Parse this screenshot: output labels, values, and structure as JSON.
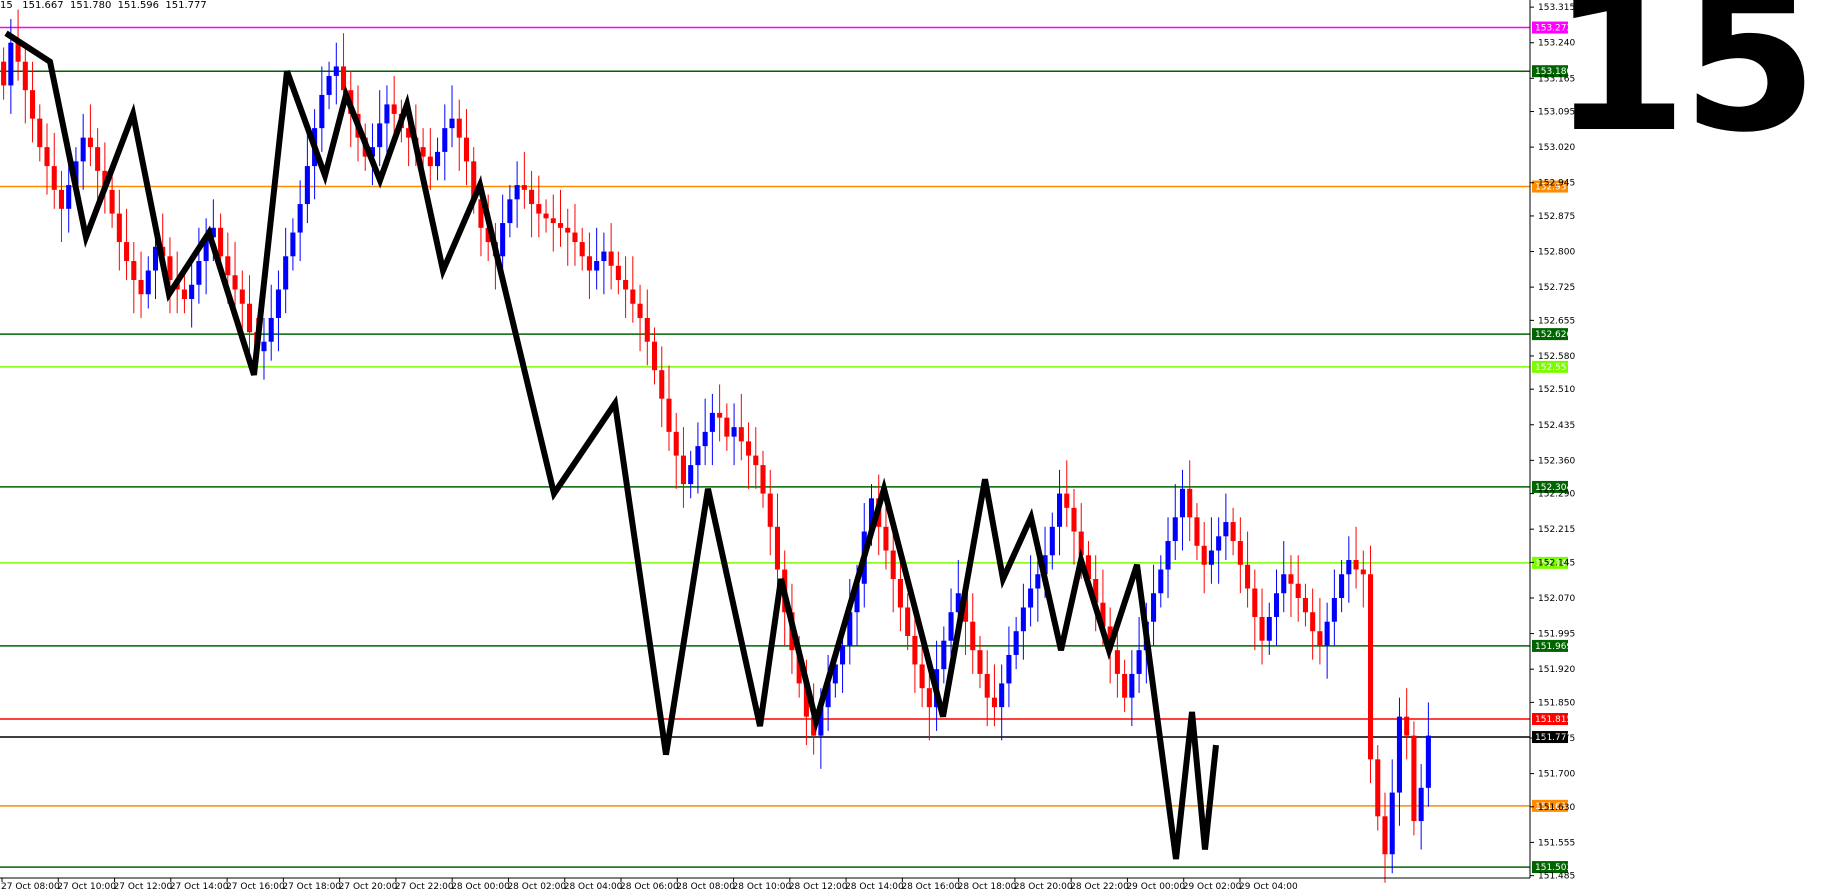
{
  "header": {
    "ohlc_text": "15   151.667  151.780  151.596  151.777"
  },
  "timeframe_label": "15",
  "chart_data": {
    "type": "candlestick",
    "ylim": [
      151.48,
      153.33
    ],
    "y_ticks": [
      "153.315",
      "153.240",
      "153.165",
      "153.095",
      "153.020",
      "152.945",
      "152.875",
      "152.800",
      "152.725",
      "152.655",
      "152.580",
      "152.510",
      "152.435",
      "152.360",
      "152.290",
      "152.215",
      "152.145",
      "152.070",
      "151.995",
      "151.920",
      "151.850",
      "151.775",
      "151.700",
      "151.630",
      "151.555",
      "151.485"
    ],
    "x_ticks": [
      "27 Oct 08:00",
      "27 Oct 10:00",
      "27 Oct 12:00",
      "27 Oct 14:00",
      "27 Oct 16:00",
      "27 Oct 18:00",
      "27 Oct 20:00",
      "27 Oct 22:00",
      "28 Oct 00:00",
      "28 Oct 02:00",
      "28 Oct 04:00",
      "28 Oct 06:00",
      "28 Oct 08:00",
      "28 Oct 10:00",
      "28 Oct 12:00",
      "28 Oct 14:00",
      "28 Oct 16:00",
      "28 Oct 18:00",
      "28 Oct 20:00",
      "28 Oct 22:00",
      "29 Oct 00:00",
      "29 Oct 02:00",
      "29 Oct 04:00"
    ],
    "levels": [
      {
        "value": "153.272",
        "color": "#ff00ff"
      },
      {
        "value": "153.180",
        "color": "#006400"
      },
      {
        "value": "152.937",
        "color": "#ff8c00"
      },
      {
        "value": "152.626",
        "color": "#006400"
      },
      {
        "value": "152.557",
        "color": "#7cfc00"
      },
      {
        "value": "152.304",
        "color": "#006400"
      },
      {
        "value": "152.144",
        "color": "#7cfc00"
      },
      {
        "value": "151.969",
        "color": "#006400"
      },
      {
        "value": "151.815",
        "color": "#ff0000"
      },
      {
        "value": "151.777",
        "color": "#000000"
      },
      {
        "value": "151.632",
        "color": "#ff8c00"
      },
      {
        "value": "151.503",
        "color": "#006400"
      }
    ],
    "candles": {
      "bull_color": "#0000ff",
      "bear_color": "#ff0000",
      "closes": [
        153.15,
        153.24,
        153.2,
        153.14,
        153.08,
        153.02,
        152.98,
        152.93,
        152.89,
        152.94,
        152.99,
        153.04,
        153.02,
        152.97,
        152.93,
        152.88,
        152.82,
        152.78,
        152.74,
        152.71,
        152.76,
        152.81,
        152.79,
        152.74,
        152.72,
        152.7,
        152.73,
        152.78,
        152.83,
        152.85,
        152.79,
        152.75,
        152.72,
        152.69,
        152.63,
        152.59,
        152.61,
        152.66,
        152.72,
        152.79,
        152.84,
        152.9,
        152.98,
        153.06,
        153.13,
        153.17,
        153.19,
        153.14,
        153.09,
        153.04,
        153.0,
        153.02,
        153.07,
        153.11,
        153.09,
        153.06,
        153.04,
        153.02,
        153.0,
        152.98,
        153.01,
        153.06,
        153.08,
        153.04,
        152.99,
        152.91,
        152.85,
        152.82,
        152.79,
        152.86,
        152.91,
        152.94,
        152.93,
        152.9,
        152.88,
        152.87,
        152.86,
        152.85,
        152.84,
        152.82,
        152.79,
        152.76,
        152.78,
        152.8,
        152.77,
        152.74,
        152.72,
        152.69,
        152.66,
        152.61,
        152.55,
        152.49,
        152.42,
        152.37,
        152.31,
        152.35,
        152.39,
        152.42,
        152.46,
        152.45,
        152.41,
        152.43,
        152.4,
        152.37,
        152.35,
        152.29,
        152.22,
        152.13,
        152.04,
        151.96,
        151.89,
        151.82,
        151.78,
        151.84,
        151.89,
        151.93,
        151.97,
        152.04,
        152.1,
        152.21,
        152.28,
        152.22,
        152.17,
        152.11,
        152.05,
        151.99,
        151.93,
        151.88,
        151.84,
        151.92,
        151.98,
        152.04,
        152.08,
        152.02,
        151.96,
        151.91,
        151.86,
        151.84,
        151.89,
        151.95,
        152.0,
        152.05,
        152.09,
        152.12,
        152.16,
        152.22,
        152.29,
        152.26,
        152.21,
        152.16,
        152.11,
        152.06,
        152.01,
        151.96,
        151.91,
        151.86,
        151.91,
        151.96,
        152.02,
        152.08,
        152.13,
        152.19,
        152.24,
        152.3,
        152.24,
        152.18,
        152.14,
        152.17,
        152.2,
        152.23,
        152.19,
        152.14,
        152.09,
        152.03,
        151.98,
        152.03,
        152.08,
        152.12,
        152.1,
        152.07,
        152.04,
        152.0,
        151.97,
        152.02,
        152.07,
        152.12,
        152.15,
        152.13,
        152.12,
        151.73,
        151.61,
        151.53,
        151.66,
        151.82,
        151.78,
        151.6,
        151.67,
        151.78
      ]
    },
    "zigzag": [
      [
        153.26,
        153.2,
        152.83,
        153.09,
        152.71,
        152.84,
        152.54,
        153.18,
        152.96,
        153.13,
        152.95,
        153.11,
        152.76,
        152.94,
        152.29,
        152.48,
        151.74,
        152.3,
        151.8,
        152.11,
        151.81,
        152.3,
        151.82,
        152.32,
        152.11,
        152.24,
        151.96,
        152.15,
        151.96,
        152.14,
        151.52,
        151.83,
        151.54,
        151.76
      ]
    ]
  }
}
